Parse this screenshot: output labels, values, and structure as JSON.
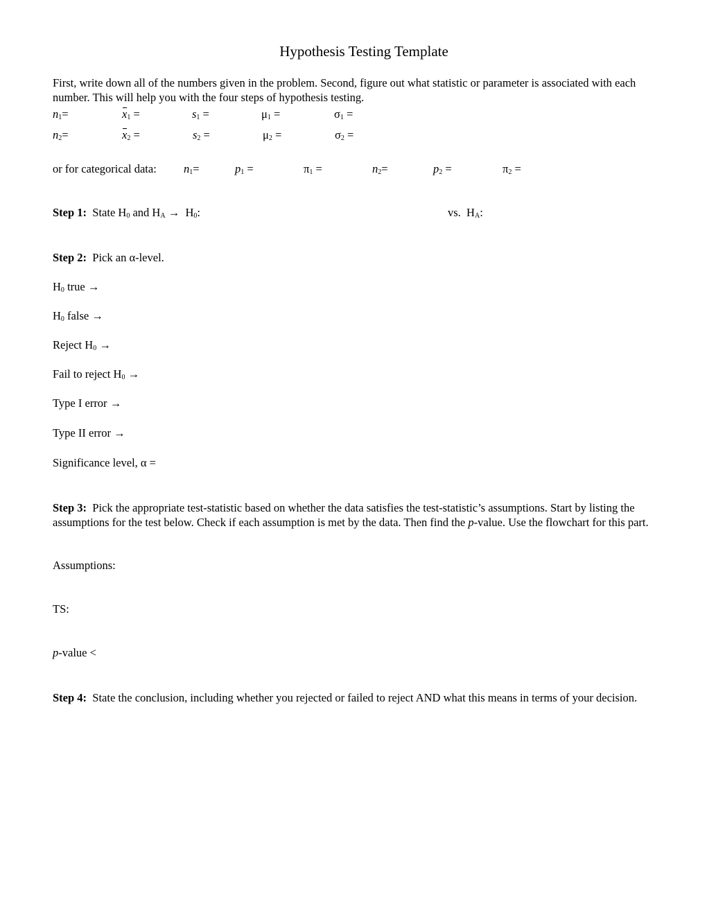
{
  "title": "Hypothesis Testing Template",
  "intro": "First, write down all of the numbers given in the problem.  Second, figure out what statistic or parameter is associated with each number.  This will help you with the four steps of hypothesis testing.",
  "numeric_row1": {
    "n": "n",
    "n_sub": "1",
    "xbar": "x",
    "xbar_sub": "1",
    "s": "s",
    "s_sub": "1",
    "mu": "μ",
    "mu_sub": "1",
    "sigma": "σ",
    "sigma_sub": "1",
    "eq": "=",
    "eq_sp": " ="
  },
  "numeric_row2": {
    "n": "n",
    "n_sub": "2",
    "xbar": "x",
    "xbar_sub": "2",
    "s": "s",
    "s_sub": "2",
    "mu": "μ",
    "mu_sub": "2",
    "sigma": "σ",
    "sigma_sub": "2",
    "eq": "=",
    "eq_sp": " ="
  },
  "categorical": {
    "label": "or for categorical data:",
    "n1": "n",
    "n1_sub": "1",
    "p1": "p",
    "p1_sub": "1",
    "pi1": "π",
    "pi1_sub": "1",
    "n2": "n",
    "n2_sub": "2",
    "p2": "p",
    "p2_sub": "2",
    "pi2": "π",
    "pi2_sub": "2",
    "eq": "=",
    "eq_sp": " ="
  },
  "step1": {
    "label": "Step 1:",
    "text_a": "State H",
    "sub0": "0",
    "text_b": " and H",
    "subA": "A",
    "arrow": "→",
    "h0": "H",
    "h0_colon": ":",
    "vs": "vs.",
    "ha": "H",
    "ha_colon": ":"
  },
  "step2": {
    "label": "Step 2:",
    "text": "Pick an α-level.",
    "items": [
      {
        "pre": "H",
        "sub": "0",
        "post": " true",
        "arrow": "→"
      },
      {
        "pre": "H",
        "sub": "0",
        "post": " false",
        "arrow": "→"
      },
      {
        "pre": "Reject H",
        "sub": "0",
        "post": "",
        "arrow": "→"
      },
      {
        "pre": "Fail to reject H",
        "sub": "0",
        "post": "",
        "arrow": "→"
      },
      {
        "pre": "Type I error",
        "sub": "",
        "post": "",
        "arrow": "→"
      },
      {
        "pre": "Type II error",
        "sub": "",
        "post": "",
        "arrow": "→"
      }
    ],
    "significance": "Significance level, α ="
  },
  "step3": {
    "label": "Step 3:",
    "text_a": "Pick the appropriate test-statistic based on whether the data satisfies the test-statistic’s assumptions.  Start by listing the assumptions for the test below.  Check if each assumption is met by the data.  Then find the ",
    "p": "p",
    "text_b": "-value.  Use the flowchart for this part.",
    "assumptions": "Assumptions:",
    "ts": "TS:",
    "pvalue_p": "p",
    "pvalue_rest": "-value <"
  },
  "step4": {
    "label": "Step 4:",
    "text": "State the conclusion, including whether you rejected or failed to reject AND what this means in terms of your decision."
  }
}
